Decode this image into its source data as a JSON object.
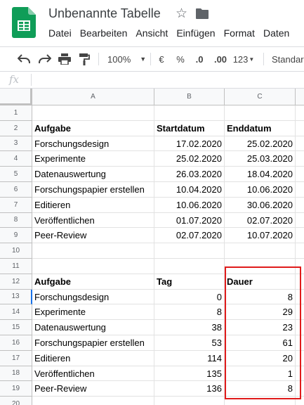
{
  "app": {
    "doc_title": "Unbenannte Tabelle",
    "brand_color": "#0f9d58"
  },
  "menu": [
    "Datei",
    "Bearbeiten",
    "Ansicht",
    "Einfügen",
    "Format",
    "Daten"
  ],
  "toolbar": {
    "zoom": "100%",
    "currency": "€",
    "percent": "%",
    "dec_decrease": ".0",
    "dec_increase": ".00",
    "more_formats": "123",
    "font": "Standard"
  },
  "formula_bar": {
    "fx": "fx",
    "value": ""
  },
  "columns": [
    "A",
    "B",
    "C"
  ],
  "rows": [
    {
      "n": "1",
      "a": "",
      "b": "",
      "c": ""
    },
    {
      "n": "2",
      "a": "Aufgabe",
      "b": "Startdatum",
      "c": "Enddatum",
      "bold": true
    },
    {
      "n": "3",
      "a": "Forschungsdesign",
      "b": "17.02.2020",
      "c": "25.02.2020"
    },
    {
      "n": "4",
      "a": "Experimente",
      "b": "25.02.2020",
      "c": "25.03.2020"
    },
    {
      "n": "5",
      "a": "Datenauswertung",
      "b": "26.03.2020",
      "c": "18.04.2020"
    },
    {
      "n": "6",
      "a": "Forschungspapier erstellen",
      "b": "10.04.2020",
      "c": "10.06.2020"
    },
    {
      "n": "7",
      "a": "Editieren",
      "b": "10.06.2020",
      "c": "30.06.2020"
    },
    {
      "n": "8",
      "a": "Veröffentlichen",
      "b": "01.07.2020",
      "c": "02.07.2020"
    },
    {
      "n": "9",
      "a": "Peer-Review",
      "b": "02.07.2020",
      "c": "10.07.2020"
    },
    {
      "n": "10",
      "a": "",
      "b": "",
      "c": ""
    },
    {
      "n": "11",
      "a": "",
      "b": "",
      "c": ""
    },
    {
      "n": "12",
      "a": "Aufgabe",
      "b": "Tag",
      "c": "Dauer",
      "bold": true
    },
    {
      "n": "13",
      "a": "Forschungsdesign",
      "b": "0",
      "c": "8"
    },
    {
      "n": "14",
      "a": "Experimente",
      "b": "8",
      "c": "29"
    },
    {
      "n": "15",
      "a": "Datenauswertung",
      "b": "38",
      "c": "23"
    },
    {
      "n": "16",
      "a": "Forschungspapier erstellen",
      "b": "53",
      "c": "61"
    },
    {
      "n": "17",
      "a": "Editieren",
      "b": "114",
      "c": "20"
    },
    {
      "n": "18",
      "a": "Veröffentlichen",
      "b": "135",
      "c": "1"
    },
    {
      "n": "19",
      "a": "Peer-Review",
      "b": "136",
      "c": "8"
    },
    {
      "n": "20",
      "a": "",
      "b": "",
      "c": ""
    }
  ],
  "highlight_color": "#e01b1b"
}
